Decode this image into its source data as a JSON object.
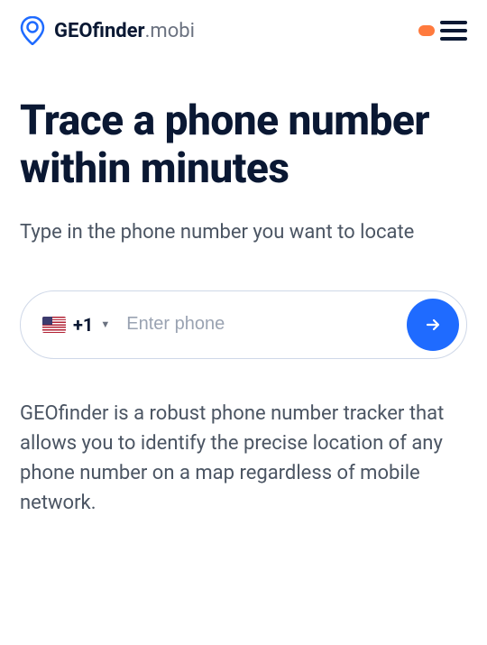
{
  "header": {
    "brand_prefix": "GEOfinder",
    "brand_suffix": ".mobi"
  },
  "hero": {
    "title": "Trace a phone number within minutes",
    "subtitle": "Type in the phone number you want to locate"
  },
  "phone_form": {
    "dial_code": "+1",
    "placeholder": "Enter phone",
    "country": "US"
  },
  "description": "GEOfinder is a robust phone number tracker that allows you to identify the precise location of any phone number on a map regardless of mobile network."
}
